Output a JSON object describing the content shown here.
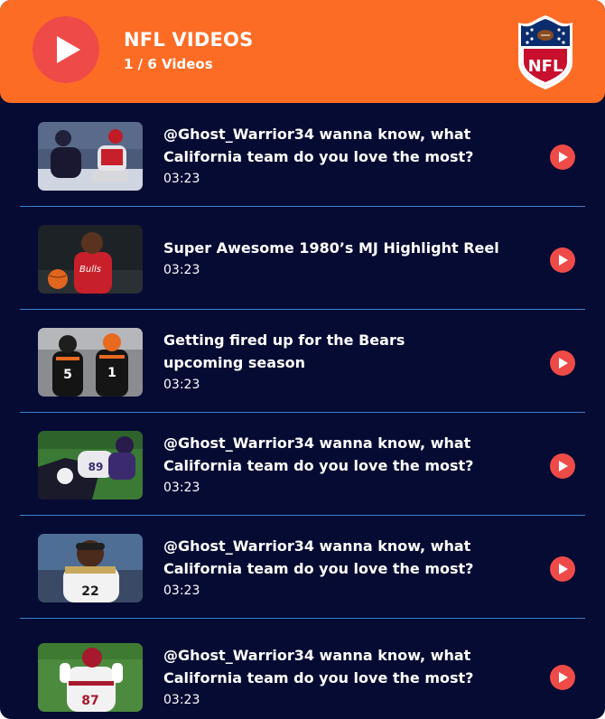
{
  "playlist": {
    "title": "NFL VIDEOS",
    "counter": "1 / 6 Videos",
    "logo_icon": "nfl-shield-logo",
    "logo_text": "NFL",
    "accent_color": "#fd6c25",
    "background_color": "#050b33",
    "play_color": "#ee4b48"
  },
  "videos": [
    {
      "title": "@Ghost_Warrior34 wanna know, what California team do you love the most?",
      "duration": "03:23"
    },
    {
      "title": "Super Awesome 1980’s MJ Highlight Reel",
      "duration": "03:23"
    },
    {
      "title": "Getting fired up for the Bears upcoming season",
      "duration": "03:23"
    },
    {
      "title": "@Ghost_Warrior34 wanna know, what California team do you love the most?",
      "duration": "03:23"
    },
    {
      "title": "@Ghost_Warrior34 wanna know, what California team do you love the most?",
      "duration": "03:23"
    },
    {
      "title": "@Ghost_Warrior34 wanna know, what California team do you love the most?",
      "duration": "03:23"
    }
  ]
}
